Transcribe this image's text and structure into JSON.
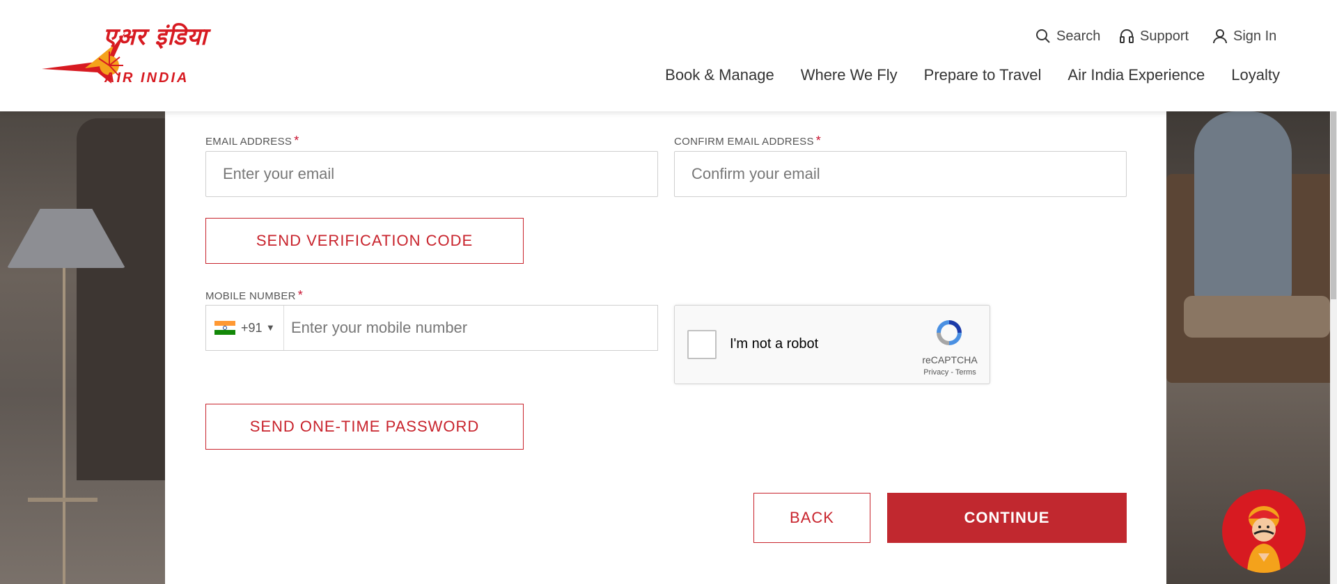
{
  "header": {
    "logo_devanagari": "एअर इंडिया",
    "logo_text": "AIR INDIA",
    "utility": {
      "search": "Search",
      "support": "Support",
      "sign_in": "Sign In"
    },
    "nav": [
      "Book & Manage",
      "Where We Fly",
      "Prepare to Travel",
      "Air India Experience",
      "Loyalty"
    ]
  },
  "form": {
    "email_label": "EMAIL ADDRESS",
    "email_placeholder": "Enter your email",
    "confirm_email_label": "CONFIRM EMAIL ADDRESS",
    "confirm_email_placeholder": "Confirm your email",
    "send_verification_label": "SEND VERIFICATION CODE",
    "mobile_label": "MOBILE NUMBER",
    "country_code": "+91",
    "mobile_placeholder": "Enter your mobile number",
    "send_otp_label": "SEND ONE-TIME PASSWORD",
    "required_mark": "*",
    "back_label": "BACK",
    "continue_label": "CONTINUE"
  },
  "captcha": {
    "text": "I'm not a robot",
    "brand": "reCAPTCHA",
    "privacy": "Privacy",
    "separator": " - ",
    "terms": "Terms"
  },
  "colors": {
    "brand_red": "#c1282f",
    "logo_red": "#d71a21"
  },
  "icons": [
    "search-icon",
    "headset-icon",
    "user-icon",
    "india-flag-icon",
    "chevron-down-icon",
    "recaptcha-logo-icon",
    "maharaja-mascot-icon"
  ]
}
